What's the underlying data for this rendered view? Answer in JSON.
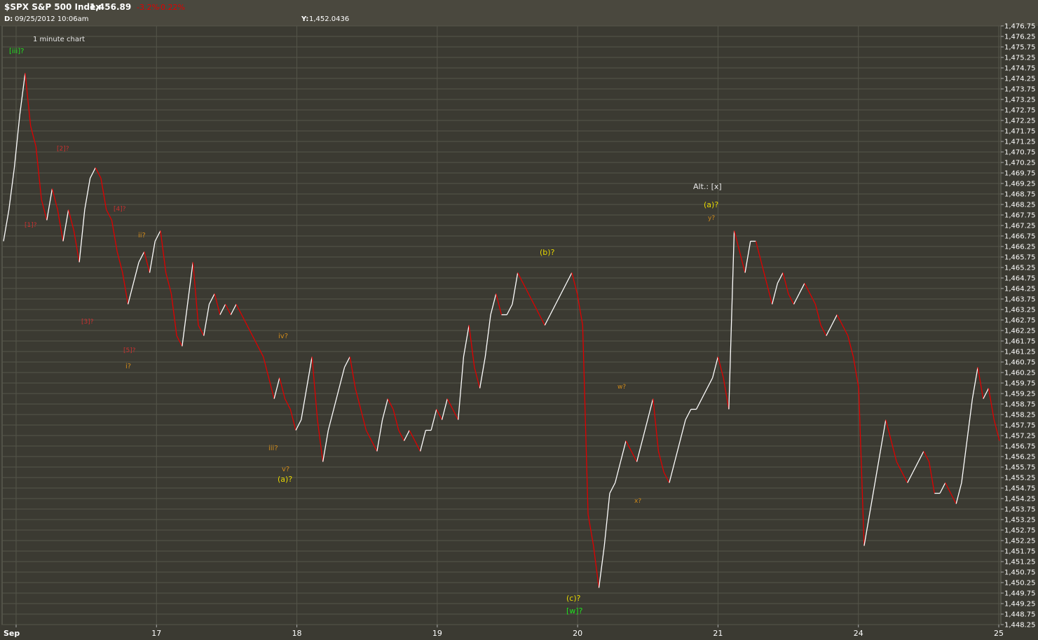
{
  "header": {
    "symbol": "$SPX S&P 500 Index",
    "last": "1,456.89",
    "change": "-3.2%",
    "change_pct": "-0.22%",
    "date_label": "D:",
    "date_value": "09/25/2012  10:06am",
    "y_label": "Y:",
    "y_value": "1,452.0436"
  },
  "chart_note": "1 minute chart",
  "colors": {
    "background": "#3b3a32",
    "header": "#4a483e",
    "grid": "#55554a",
    "up": "#ffffff",
    "down": "#e00000",
    "label_yellow": "#e8d800",
    "label_orange": "#d08a1a",
    "label_red": "#c83030",
    "label_green": "#20e020",
    "label_white": "#e8e8e8"
  },
  "chart_data": {
    "type": "line",
    "title": "$SPX S&P 500 Index",
    "xlabel": "",
    "ylabel": "",
    "ylim": [
      1448.25,
      1476.75
    ],
    "y_tick_step": 0.5,
    "grid": true,
    "x_ticks": [
      "Sep",
      "17",
      "18",
      "19",
      "20",
      "21",
      "24",
      "25"
    ],
    "series": [
      {
        "values": [
          1466.5,
          1468.0,
          1470.0,
          1472.5,
          1474.5,
          1472.0,
          1471.0,
          1468.5,
          1467.5,
          1469.0,
          1468.0,
          1466.5,
          1468.0,
          1467.0,
          1465.5,
          1468.0,
          1469.5,
          1470.0,
          1469.5,
          1468.0,
          1467.5,
          1466.0,
          1465.0,
          1463.5,
          1464.5,
          1465.5,
          1466.0,
          1465.0,
          1466.5,
          1467.0,
          1465.0,
          1464.0,
          1462.0,
          1461.5,
          1463.5,
          1465.5,
          1462.5,
          1462.0,
          1463.5,
          1464.0,
          1463.0,
          1463.5,
          1463.0,
          1463.5,
          1463.0,
          1462.5,
          1462.0,
          1461.5,
          1461.0,
          1460.0,
          1459.0,
          1460.0,
          1459.0,
          1458.5,
          1457.5,
          1458.0,
          1459.5,
          1461.0,
          1458.0,
          1456.0,
          1457.5,
          1458.5,
          1459.5,
          1460.5,
          1461.0,
          1459.5,
          1458.5,
          1457.5,
          1457.0,
          1456.5,
          1458.0,
          1459.0,
          1458.5,
          1457.5,
          1457.0,
          1457.5,
          1457.0,
          1456.5,
          1457.5,
          1457.5,
          1458.5,
          1458.0,
          1459.0,
          1458.5,
          1458.0,
          1461.0,
          1462.5,
          1460.5,
          1459.5,
          1461.0,
          1463.0,
          1464.0,
          1463.0,
          1463.0,
          1463.5,
          1465.0,
          1464.5,
          1464.0,
          1463.5,
          1463.0,
          1462.5,
          1463.0,
          1463.5,
          1464.0,
          1464.5,
          1465.0,
          1464.0,
          1462.5,
          1453.5,
          1452.0,
          1450.0,
          1452.0,
          1454.5,
          1455.0,
          1456.0,
          1457.0,
          1456.5,
          1456.0,
          1457.0,
          1458.0,
          1459.0,
          1456.5,
          1455.5,
          1455.0,
          1456.0,
          1457.0,
          1458.0,
          1458.5,
          1458.5,
          1459.0,
          1459.5,
          1460.0,
          1461.0,
          1460.0,
          1458.5,
          1467.0,
          1466.0,
          1465.0,
          1466.5,
          1466.5,
          1465.5,
          1464.5,
          1463.5,
          1464.5,
          1465.0,
          1464.0,
          1463.5,
          1464.0,
          1464.5,
          1464.0,
          1463.5,
          1462.5,
          1462.0,
          1462.5,
          1463.0,
          1462.5,
          1462.0,
          1461.0,
          1459.5,
          1452.0,
          1453.5,
          1455.0,
          1456.5,
          1458.0,
          1457.0,
          1456.0,
          1455.5,
          1455.0,
          1455.5,
          1456.0,
          1456.5,
          1456.0,
          1454.5,
          1454.5,
          1455.0,
          1454.5,
          1454.0,
          1455.0,
          1457.0,
          1459.0,
          1460.5,
          1459.0,
          1459.5,
          1458.0,
          1457.0
        ]
      }
    ],
    "annotations": [
      {
        "text": "[iii]?",
        "color": "green"
      },
      {
        "text": "[2]?",
        "color": "red"
      },
      {
        "text": "[1]?",
        "color": "red"
      },
      {
        "text": "[4]?",
        "color": "red"
      },
      {
        "text": "[3]?",
        "color": "red"
      },
      {
        "text": "[5]?",
        "color": "red"
      },
      {
        "text": "ii?",
        "color": "orange"
      },
      {
        "text": "i?",
        "color": "orange"
      },
      {
        "text": "iv?",
        "color": "orange"
      },
      {
        "text": "iii?",
        "color": "orange"
      },
      {
        "text": "v?",
        "color": "orange"
      },
      {
        "text": "(a)?",
        "color": "yellow"
      },
      {
        "text": "(b)?",
        "color": "yellow"
      },
      {
        "text": "(c)?",
        "color": "yellow"
      },
      {
        "text": "[w]?",
        "color": "green"
      },
      {
        "text": "w?",
        "color": "orange"
      },
      {
        "text": "x?",
        "color": "orange"
      },
      {
        "text": "Alt.: [x]",
        "color": "white"
      },
      {
        "text": "(a)?",
        "color": "yellow"
      },
      {
        "text": "y?",
        "color": "orange"
      }
    ]
  }
}
